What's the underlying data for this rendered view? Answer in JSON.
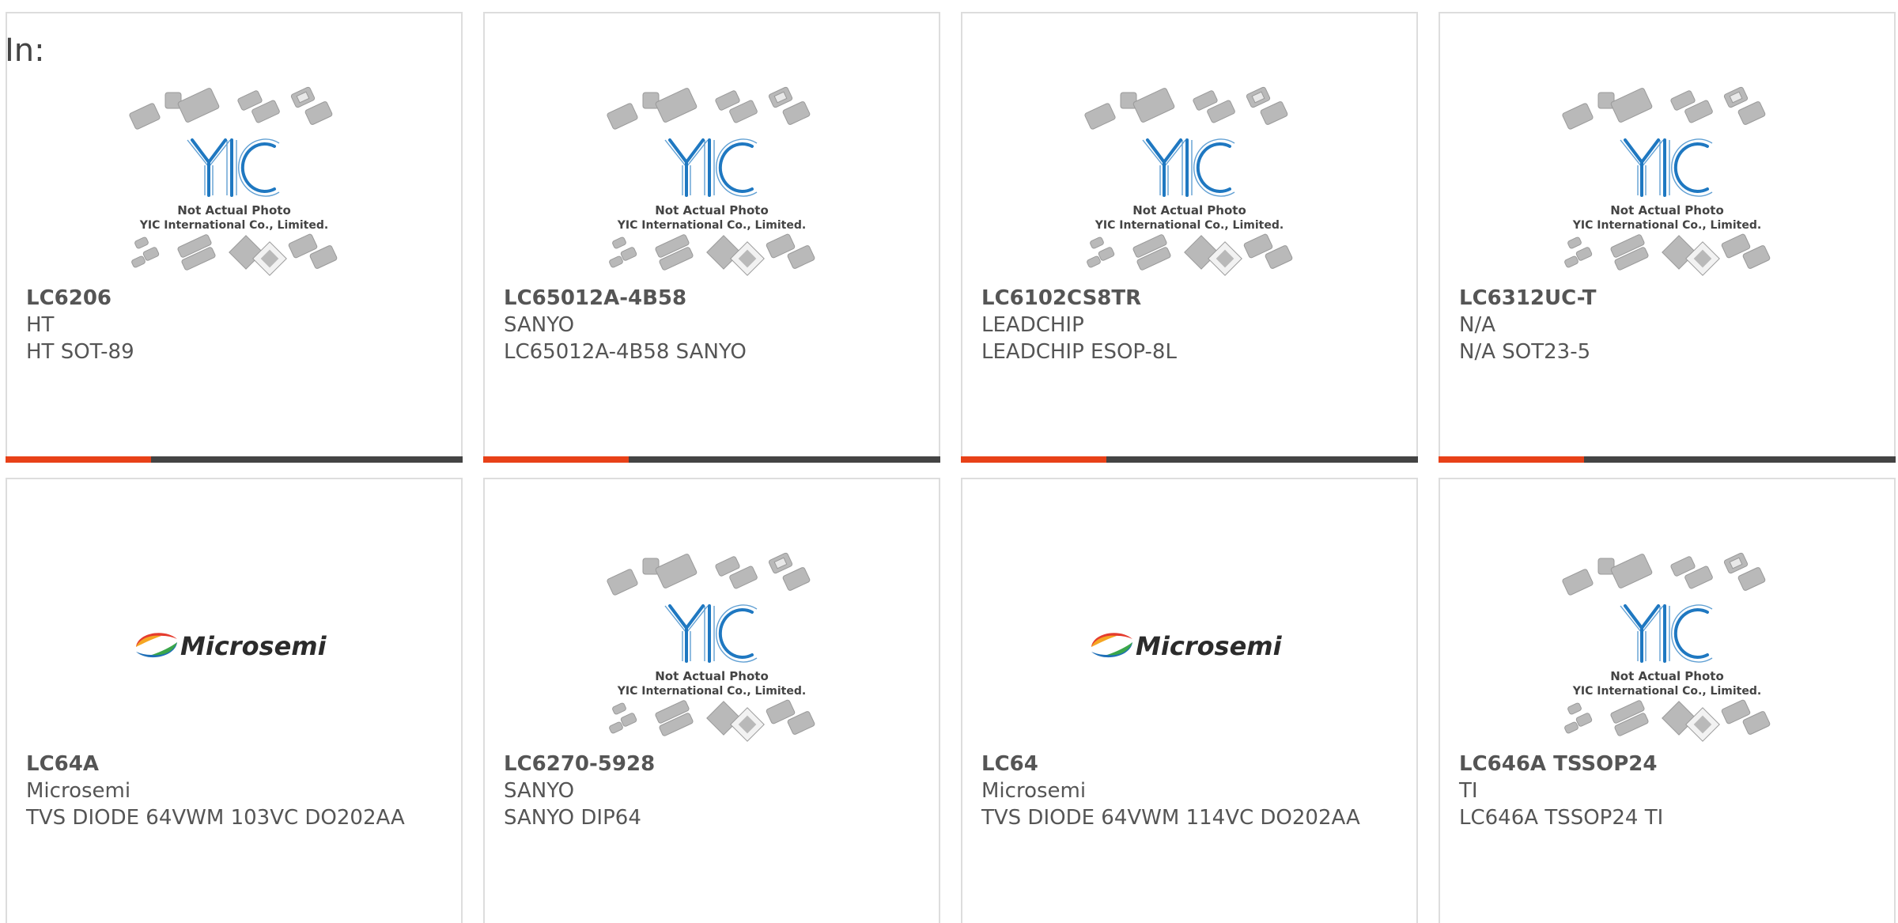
{
  "prefix_label": "In:",
  "colors": {
    "accent": "#e84118",
    "bar_dark": "#444444",
    "yic_blue": "#1f78c1",
    "chip_gray": "#b9b9b9"
  },
  "placeholder_image": {
    "brand": "YIC",
    "caption_line1": "Not Actual Photo",
    "caption_line2": "YIC International Co., Limited."
  },
  "microsemi_logo": {
    "text": "Microsemi"
  },
  "products": [
    {
      "part": "LC6206",
      "manufacturer": "HT",
      "description": "HT SOT-89",
      "image": "placeholder"
    },
    {
      "part": "LC65012A-4B58",
      "manufacturer": "SANYO",
      "description": "LC65012A-4B58 SANYO",
      "image": "placeholder"
    },
    {
      "part": "LC6102CS8TR",
      "manufacturer": "LEADCHIP",
      "description": "LEADCHIP ESOP-8L",
      "image": "placeholder"
    },
    {
      "part": "LC6312UC-T",
      "manufacturer": "N/A",
      "description": "N/A SOT23-5",
      "image": "placeholder"
    },
    {
      "part": "LC64A",
      "manufacturer": "Microsemi",
      "description": "TVS DIODE 64VWM 103VC DO202AA",
      "image": "microsemi"
    },
    {
      "part": "LC6270-5928",
      "manufacturer": "SANYO",
      "description": "SANYO DIP64",
      "image": "placeholder"
    },
    {
      "part": "LC64",
      "manufacturer": "Microsemi",
      "description": "TVS DIODE 64VWM 114VC DO202AA",
      "image": "microsemi"
    },
    {
      "part": "LC646A TSSOP24",
      "manufacturer": "TI",
      "description": "LC646A TSSOP24 TI",
      "image": "placeholder"
    }
  ]
}
